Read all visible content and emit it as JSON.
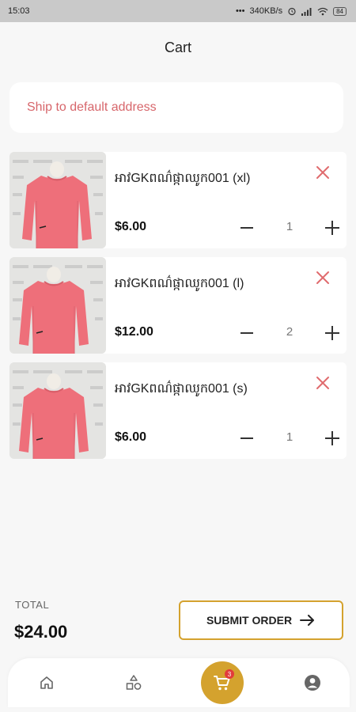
{
  "status_bar": {
    "time": "15:03",
    "speed": "340KB/s",
    "battery": "84"
  },
  "header": {
    "title": "Cart"
  },
  "address": {
    "label": "Ship to default address"
  },
  "items": [
    {
      "name": "អាវGKពណ៌ផ្កាឈូក001 (xl)",
      "price": "$6.00",
      "quantity": "1"
    },
    {
      "name": "អាវGKពណ៌ផ្កាឈូក001 (l)",
      "price": "$12.00",
      "quantity": "2"
    },
    {
      "name": "អាវGKពណ៌ផ្កាឈូក001 (s)",
      "price": "$6.00",
      "quantity": "1"
    }
  ],
  "summary": {
    "total_label": "TOTAL",
    "total_value": "$24.00",
    "submit_label": "SUBMIT ORDER"
  },
  "bottom_nav": {
    "cart_badge": "3",
    "items": [
      "home-icon",
      "categories-icon",
      "cart-icon",
      "profile-icon"
    ]
  },
  "colors": {
    "accent": "#d4a22e",
    "remove": "#e06b6e",
    "address_text": "#d7666b",
    "badge": "#e23b3b"
  }
}
